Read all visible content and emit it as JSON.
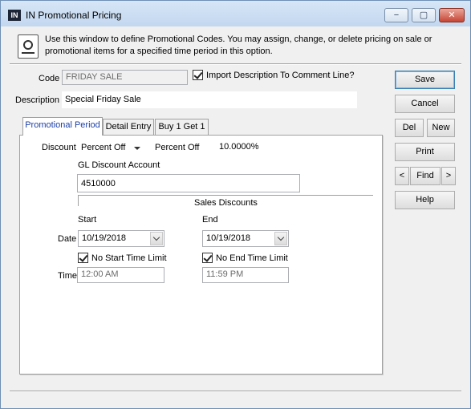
{
  "window": {
    "app_badge": "IN",
    "title": "IN Promotional Pricing",
    "controls": {
      "minimize": "−",
      "maximize": "▢",
      "close": "✕"
    }
  },
  "info": {
    "text": "Use this window to define Promotional Codes.  You may assign, change, or delete pricing on sale or promotional items for a specified time period in this option."
  },
  "header": {
    "code_label": "Code",
    "code_value": "FRIDAY SALE",
    "import_desc_label": "Import Description To Comment Line?",
    "import_desc_checked": true,
    "description_label": "Description",
    "description_value": "Special Friday Sale"
  },
  "tabs": [
    {
      "label": "Promotional Period",
      "active": true
    },
    {
      "label": "Detail Entry",
      "active": false
    },
    {
      "label": "Buy 1 Get 1",
      "active": false
    }
  ],
  "panel": {
    "discount_label": "Discount",
    "discount_type": "Percent Off",
    "percent_off_label": "Percent Off",
    "percent_off_value": "10.0000%",
    "gl_label": "GL Discount Account",
    "gl_value": "4510000",
    "gl_desc": "Sales Discounts",
    "start_label": "Start",
    "end_label": "End",
    "date_label": "Date",
    "start_date": "10/19/2018",
    "end_date": "10/19/2018",
    "no_start_label": "No Start Time Limit",
    "no_end_label": "No End Time Limit",
    "no_start_checked": true,
    "no_end_checked": true,
    "time_label": "Time",
    "start_time": "12:00 AM",
    "end_time": "11:59 PM"
  },
  "buttons": {
    "save": "Save",
    "cancel": "Cancel",
    "del": "Del",
    "new": "New",
    "print": "Print",
    "prev": "<",
    "find": "Find",
    "next": ">",
    "help": "Help"
  }
}
